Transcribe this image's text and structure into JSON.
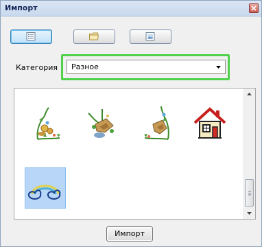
{
  "window": {
    "title": "Импорт"
  },
  "toolbar": {
    "buttons": [
      {
        "icon": "list-view-icon",
        "active": true
      },
      {
        "icon": "folder-icon",
        "active": false
      },
      {
        "icon": "picture-icon",
        "active": false
      }
    ]
  },
  "category": {
    "label": "Категория",
    "selected": "Разное"
  },
  "gallery": {
    "items": [
      {
        "icon": "floral-corner-left-icon",
        "selected": false
      },
      {
        "icon": "floral-bouquet-icon",
        "selected": false
      },
      {
        "icon": "floral-corner-right-icon",
        "selected": false
      },
      {
        "icon": "house-icon",
        "selected": false
      },
      {
        "icon": "rainbow-cloud-icon",
        "selected": true
      }
    ]
  },
  "footer": {
    "import_label": "Импорт"
  },
  "colors": {
    "highlight": "#4fd14a",
    "active_button": "#bfe1f8",
    "selection": "#b8d6f8"
  }
}
